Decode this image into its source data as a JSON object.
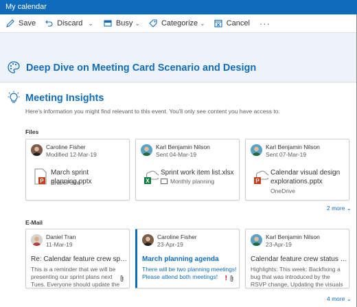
{
  "window": {
    "title": "My calendar"
  },
  "toolbar": {
    "save": "Save",
    "discard": "Discard",
    "busy": "Busy",
    "categorize": "Categorize",
    "cancel": "Cancel",
    "more": "···"
  },
  "event": {
    "title": "Deep Dive on Meeting Card Scenario and Design"
  },
  "insights": {
    "title": "Meeting Insights",
    "subtitle": "Here's information you might find relevant to this event. You'll only see content you have access to.",
    "files_label": "Files",
    "files": [
      {
        "person": "Caroline Fisher",
        "meta": "Modified 12-Mar-19",
        "name": "March sprint planning.pptx",
        "location": "SharePoint",
        "icon": "powerpoint-file-icon"
      },
      {
        "person": "Karl Benjamin Nilson",
        "meta": "Sent 04-Mar-19",
        "name": "Sprint work item list.xlsx",
        "location": "Monthly planning",
        "icon": "excel-file-icon"
      },
      {
        "person": "Karl Benjamin Nilson",
        "meta": "Sent 07-Mar-19",
        "name": "Calendar visual design explorations.pptx",
        "location": "OneDrive",
        "icon": "powerpoint-file-icon"
      }
    ],
    "files_more": "2 more",
    "email_label": "E-Mail",
    "emails": [
      {
        "person": "Daniel Tran",
        "date": "11-Mar-19",
        "subject": "Re: Calendar feature crew sprint …",
        "body": "This is a reminder that we will be presenting our sprint plans next Tues. Everyone should update the deck …"
      },
      {
        "person": "Caroline Fisher",
        "date": "23-Apr-19",
        "subject": "March planning agenda",
        "body": "There will be two planning meetings! Please attend both meetings!",
        "important": "!"
      },
      {
        "person": "Karl Benjamin Nilson",
        "date": "23-Apr-19",
        "subject": "Calendar feature crew status report",
        "body": "Highlights:  This week:  Backfixing a bug that was introduced by the RSVP change, Updating the visuals of the scheduling …"
      }
    ],
    "emails_more": "4 more"
  },
  "colors": {
    "accent": "#0f6cbd",
    "titlebar": "#0f6cbd",
    "important": "#c50f1f"
  }
}
